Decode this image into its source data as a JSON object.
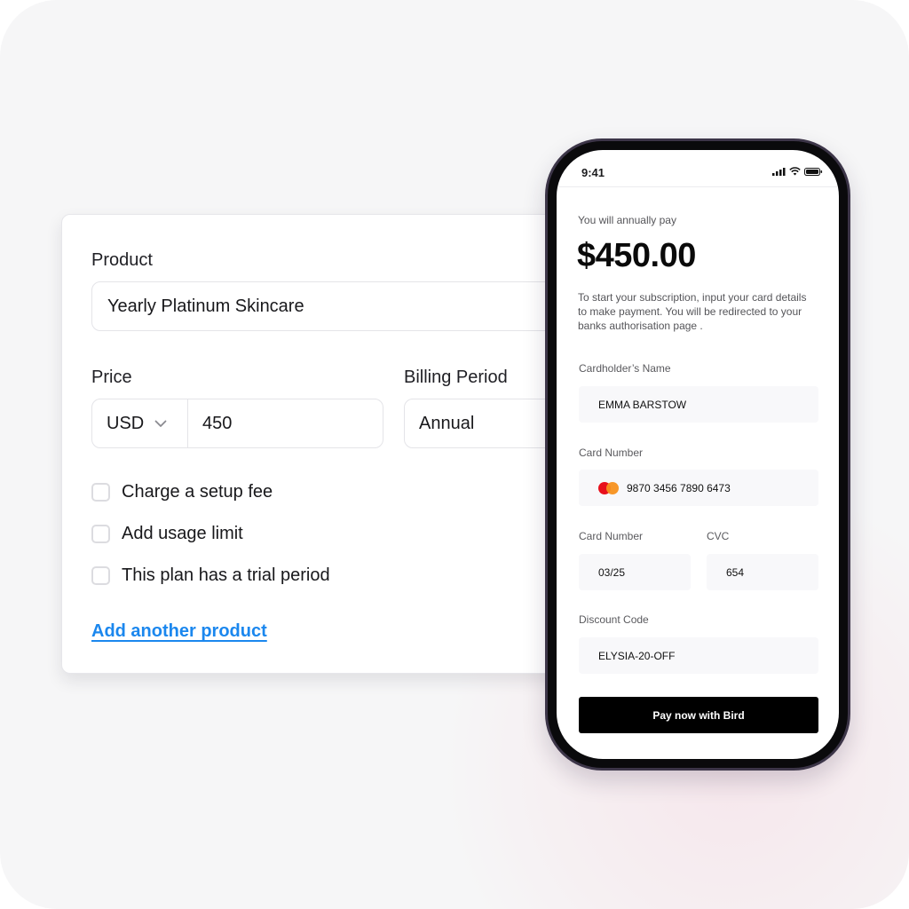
{
  "form": {
    "product_label": "Product",
    "product_value": "Yearly Platinum Skincare",
    "price_label": "Price",
    "currency_value": "USD",
    "price_value": "450",
    "billing_label": "Billing Period",
    "billing_value": "Annual",
    "checkboxes": [
      {
        "label": "Charge a setup fee",
        "checked": false
      },
      {
        "label": "Add usage limit",
        "checked": false
      },
      {
        "label": "This plan has a trial period",
        "checked": false
      }
    ],
    "add_link": "Add another product",
    "link_color": "#1b87ee"
  },
  "phone": {
    "status_time": "9:41",
    "status_icons": [
      "signal-icon",
      "wifi-icon",
      "battery-icon"
    ],
    "pay_intro": "You will annually pay",
    "amount": "$450.00",
    "description": "To start your subscription, input your card details to make payment. You will be redirected to your banks authorisation page .",
    "cardholder_label": "Cardholder’s Name",
    "cardholder_value": "EMMA BARSTOW",
    "card_number_label": "Card Number",
    "card_number_value": "9870 3456 7890 6473",
    "card_brand_icon": "mastercard-icon",
    "expiry_label": "Card Number",
    "expiry_value": "03/25",
    "cvc_label": "CVC",
    "cvc_value": "654",
    "discount_label": "Discount Code",
    "discount_value": "ELYSIA-20-OFF",
    "pay_button": "Pay now with Bird"
  }
}
